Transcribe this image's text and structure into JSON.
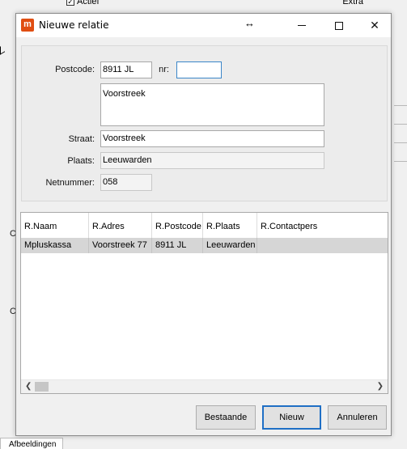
{
  "background": {
    "checkbox_label": "Actief",
    "extra_label": "Extra",
    "side_letter_1": "C",
    "side_letter_2": "C",
    "bottom_tab": "Afbeeldingen"
  },
  "dialog": {
    "title": "Nieuwe relatie",
    "icon_text": "m",
    "accent_color": "#1f6fc5",
    "form": {
      "postcode_label": "Postcode:",
      "postcode_value": "8911 JL",
      "nr_label": "nr:",
      "nr_value": "",
      "address_memo": "Voorstreek",
      "straat_label": "Straat:",
      "straat_value": "Voorstreek",
      "plaats_label": "Plaats:",
      "plaats_value": "Leeuwarden",
      "netnummer_label": "Netnummer:",
      "netnummer_value": "058"
    },
    "grid": {
      "columns": [
        "R.Naam",
        "R.Adres",
        "R.Postcode",
        "R.Plaats",
        "R.Contactpers"
      ],
      "rows": [
        [
          "Mpluskassa",
          "Voorstreek 77",
          "8911 JL",
          "Leeuwarden",
          ""
        ]
      ]
    },
    "buttons": {
      "bestaande": "Bestaande",
      "nieuw": "Nieuw",
      "annuleren": "Annuleren"
    }
  }
}
